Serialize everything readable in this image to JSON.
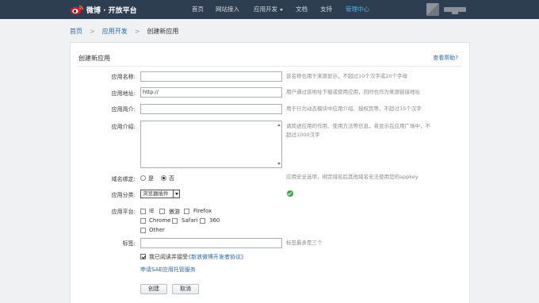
{
  "nav": {
    "logo_text": "微博 · 开放平台",
    "items": [
      {
        "label": "首页"
      },
      {
        "label": "网站接入"
      },
      {
        "label": "应用开发"
      },
      {
        "label": "文档"
      },
      {
        "label": "支持"
      },
      {
        "label": "管理中心"
      }
    ]
  },
  "breadcrumb": {
    "home": "首页",
    "section": "应用开发",
    "current": "创建新应用",
    "separator": ">"
  },
  "form": {
    "title": "创建新应用",
    "help": "查看帮助?",
    "app_name": {
      "label": "应用名称:",
      "value": "",
      "hint": "该名称也用于来源显示，不超过10个汉字或20个字母"
    },
    "app_url": {
      "label": "应用地址:",
      "value": "http://",
      "hint": "用户通过该地址下载或使用应用，同时也作为来源链接地址"
    },
    "app_brief": {
      "label": "应用简介:",
      "value": "",
      "hint": "用于行为动态模块中应用介绍、授权页等，不超过15个汉字"
    },
    "app_desc": {
      "label": "应用介绍:",
      "hint": "请简述应用的作用、使用方法等信息，将显示在应用广场中，不超过1000汉字"
    },
    "bind": {
      "label": "域名绑定:",
      "yes": "是",
      "no": "否",
      "hint": "应用安全选项，绑定域名后其他域名无法使用您的appkey",
      "selected": "否"
    },
    "category": {
      "label": "应用分类:",
      "value": "浏览器插件"
    },
    "platform": {
      "label": "应用平台:",
      "options": [
        "IE",
        "傲游",
        "Firefox",
        "Chrome",
        "Safari",
        "360",
        "Other"
      ]
    },
    "tags": {
      "label": "标签:",
      "value": "",
      "hint": "标签最多是三个"
    },
    "agree": {
      "prefix": "我已阅读并接受",
      "link": "《新浪微博开发者协议》",
      "checked": true
    },
    "sae_link": "申请SAE应用托管服务",
    "create_btn": "创建",
    "cancel_btn": "取消"
  },
  "colors": {
    "nav_bg": "#2d3e50",
    "nav_active": "#4ab3e8",
    "link": "#2a6aa8",
    "ok": "#3fa544"
  }
}
